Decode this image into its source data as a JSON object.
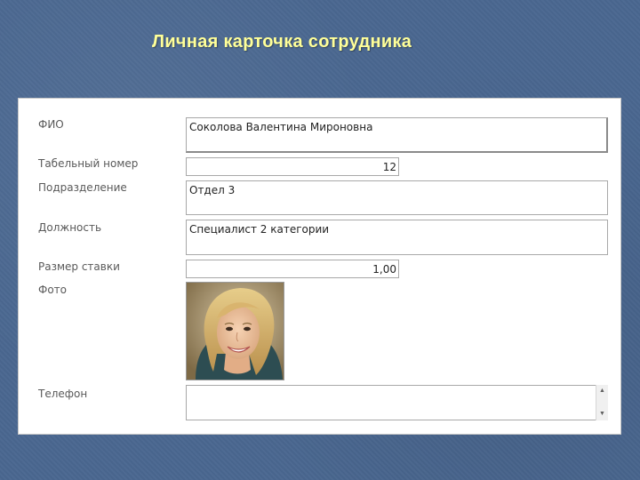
{
  "title": "Личная карточка сотрудника",
  "fields": {
    "fio": {
      "label": "ФИО",
      "value": "Соколова Валентина Мироновна"
    },
    "tab_number": {
      "label": "Табельный номер",
      "value": "12"
    },
    "department": {
      "label": "Подразделение",
      "value": "Отдел 3"
    },
    "position": {
      "label": "Должность",
      "value": "Специалист 2 категории"
    },
    "rate": {
      "label": "Размер ставки",
      "value": "1,00"
    },
    "photo": {
      "label": "Фото"
    },
    "phone": {
      "label": "Телефон",
      "value": ""
    }
  },
  "icons": {
    "photo": "employee-photo",
    "scroll_up": "scroll-up-arrow-icon",
    "scroll_down": "scroll-down-arrow-icon"
  }
}
